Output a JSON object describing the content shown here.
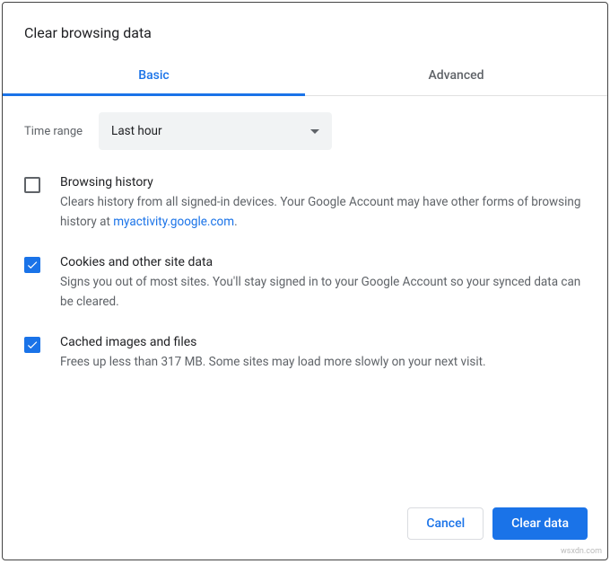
{
  "dialog": {
    "title": "Clear browsing data"
  },
  "tabs": {
    "basic": "Basic",
    "advanced": "Advanced"
  },
  "time_range": {
    "label": "Time range",
    "selected": "Last hour"
  },
  "options": {
    "browsing_history": {
      "title": "Browsing history",
      "desc_prefix": "Clears history from all signed-in devices. Your Google Account may have other forms of browsing history at ",
      "link_text": "myactivity.google.com",
      "desc_suffix": ".",
      "checked": false
    },
    "cookies": {
      "title": "Cookies and other site data",
      "desc": "Signs you out of most sites. You'll stay signed in to your Google Account so your synced data can be cleared.",
      "checked": true
    },
    "cache": {
      "title": "Cached images and files",
      "desc": "Frees up less than 317 MB. Some sites may load more slowly on your next visit.",
      "checked": true
    }
  },
  "actions": {
    "cancel": "Cancel",
    "confirm": "Clear data"
  },
  "watermark": "wsxdn.com"
}
